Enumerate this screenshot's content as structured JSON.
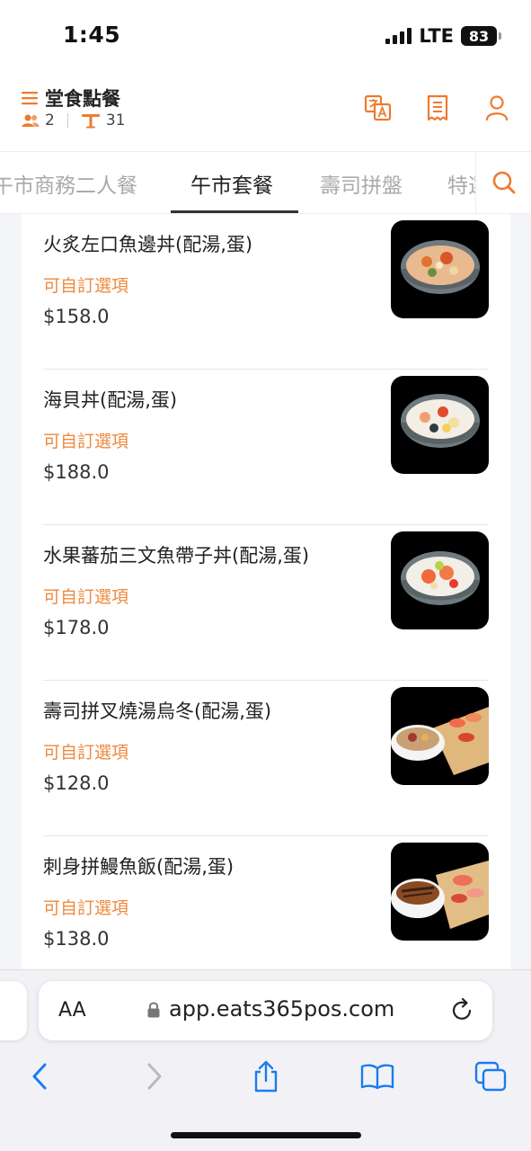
{
  "status_bar": {
    "time": "1:45",
    "network": "LTE",
    "battery": "83"
  },
  "header": {
    "title": "堂食點餐",
    "guests": "2",
    "table": "31",
    "icons": [
      "menu-icon",
      "people-icon",
      "table-icon",
      "translate-icon",
      "receipt-icon",
      "user-icon"
    ]
  },
  "tabs": [
    {
      "label": "午市商務二人餐",
      "active": false
    },
    {
      "label": "午市套餐",
      "active": true
    },
    {
      "label": "壽司拼盤",
      "active": false
    },
    {
      "label": "特選",
      "active": false
    }
  ],
  "menu_items": [
    {
      "name": "火炙左口魚邊丼(配湯,蛋)",
      "option": "可自訂選項",
      "price": "$158.0"
    },
    {
      "name": "海貝丼(配湯,蛋)",
      "option": "可自訂選項",
      "price": "$188.0"
    },
    {
      "name": "水果蕃茄三文魚帶子丼(配湯,蛋)",
      "option": "可自訂選項",
      "price": "$178.0"
    },
    {
      "name": "壽司拼叉燒湯烏冬(配湯,蛋)",
      "option": "可自訂選項",
      "price": "$128.0"
    },
    {
      "name": "刺身拼鰻魚飯(配湯,蛋)",
      "option": "可自訂選項",
      "price": "$138.0"
    }
  ],
  "browser": {
    "aa_label": "AA",
    "url": "app.eats365pos.com"
  },
  "colors": {
    "accent": "#ee7a2e",
    "option_text": "#ee8a3e",
    "ios_blue": "#1a7cf0"
  }
}
